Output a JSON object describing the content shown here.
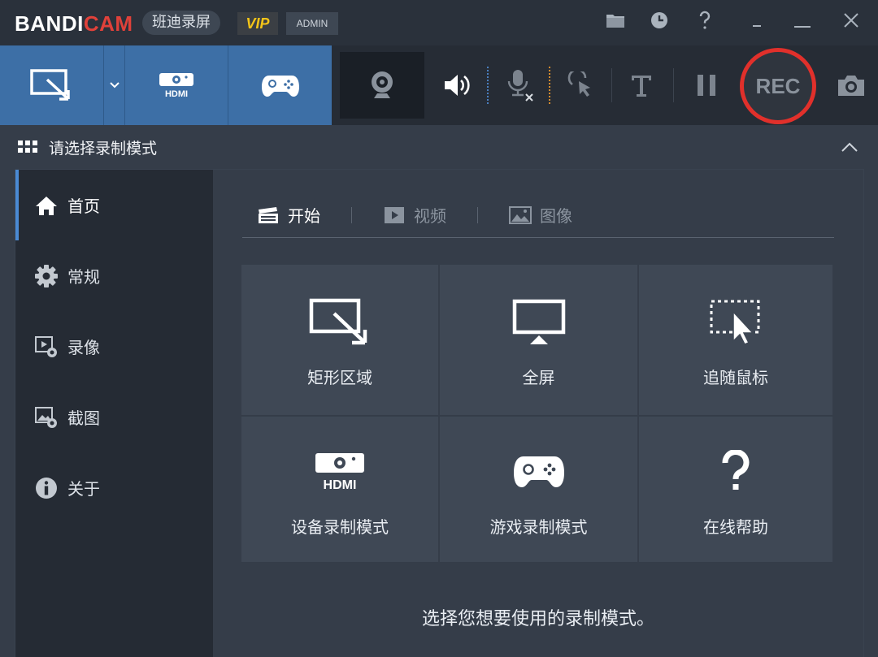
{
  "titlebar": {
    "logo_bandi": "BANDI",
    "logo_cam": "CAM",
    "logo_cn": "班迪录屏",
    "vip_badge": "VIP",
    "admin_badge": "ADMIN",
    "icons": [
      "folder-icon",
      "clock-icon",
      "help-icon",
      "minimize-icon",
      "close-icon"
    ]
  },
  "toolbar": {
    "mode_buttons": [
      "rectangle-area-mode",
      "hdmi-device-mode",
      "game-mode"
    ],
    "tools": [
      "webcam-icon",
      "speaker-icon",
      "microphone-icon",
      "mouse-click-icon",
      "text-icon",
      "pause-icon",
      "camera-icon"
    ],
    "rec_label": "REC"
  },
  "mode_header": {
    "title": "请选择录制模式"
  },
  "sidebar": {
    "items": [
      {
        "label": "首页",
        "icon": "home-icon",
        "active": true
      },
      {
        "label": "常规",
        "icon": "gear-icon",
        "active": false
      },
      {
        "label": "录像",
        "icon": "video-settings-icon",
        "active": false
      },
      {
        "label": "截图",
        "icon": "image-settings-icon",
        "active": false
      },
      {
        "label": "关于",
        "icon": "info-icon",
        "active": false
      }
    ]
  },
  "main": {
    "tabs": [
      {
        "label": "开始",
        "icon": "clapperboard-icon",
        "active": true
      },
      {
        "label": "视频",
        "icon": "video-icon",
        "active": false
      },
      {
        "label": "图像",
        "icon": "image-icon",
        "active": false
      }
    ],
    "tiles": [
      {
        "label": "矩形区域",
        "icon": "rectangle-area-icon"
      },
      {
        "label": "全屏",
        "icon": "monitor-icon"
      },
      {
        "label": "追随鼠标",
        "icon": "follow-mouse-icon"
      },
      {
        "label": "设备录制模式",
        "icon": "hdmi-icon"
      },
      {
        "label": "游戏录制模式",
        "icon": "gamepad-icon"
      },
      {
        "label": "在线帮助",
        "icon": "question-icon"
      }
    ],
    "hint": "选择您想要使用的录制模式。"
  },
  "colors": {
    "accent_blue": "#3d6fa6",
    "rec_red": "#e1302b",
    "brand_red": "#e0413a",
    "vip_gold": "#f5c518"
  }
}
